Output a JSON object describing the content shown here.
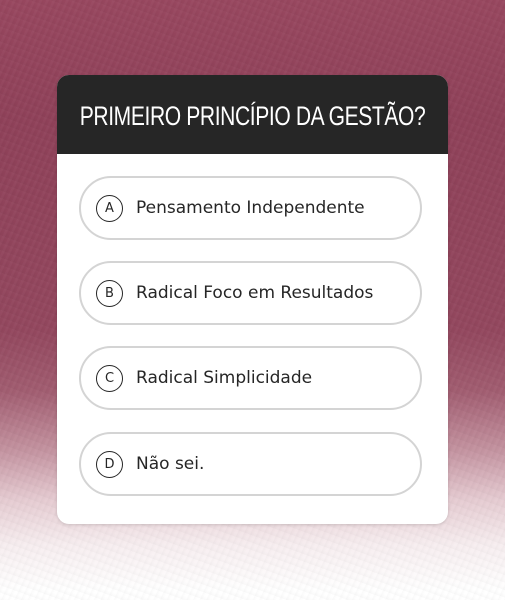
{
  "quiz": {
    "question": "PRIMEIRO PRINCÍPIO DA GESTÃO?",
    "options": [
      {
        "letter": "A",
        "label": "Pensamento Independente"
      },
      {
        "letter": "B",
        "label": "Radical Foco em Resultados"
      },
      {
        "letter": "C",
        "label": "Radical Simplicidade"
      },
      {
        "letter": "D",
        "label": "Não sei."
      }
    ]
  },
  "colors": {
    "background": "#93475e",
    "header": "#262626",
    "card": "#ffffff",
    "option_border": "#d4d4d4",
    "text": "#262626"
  }
}
